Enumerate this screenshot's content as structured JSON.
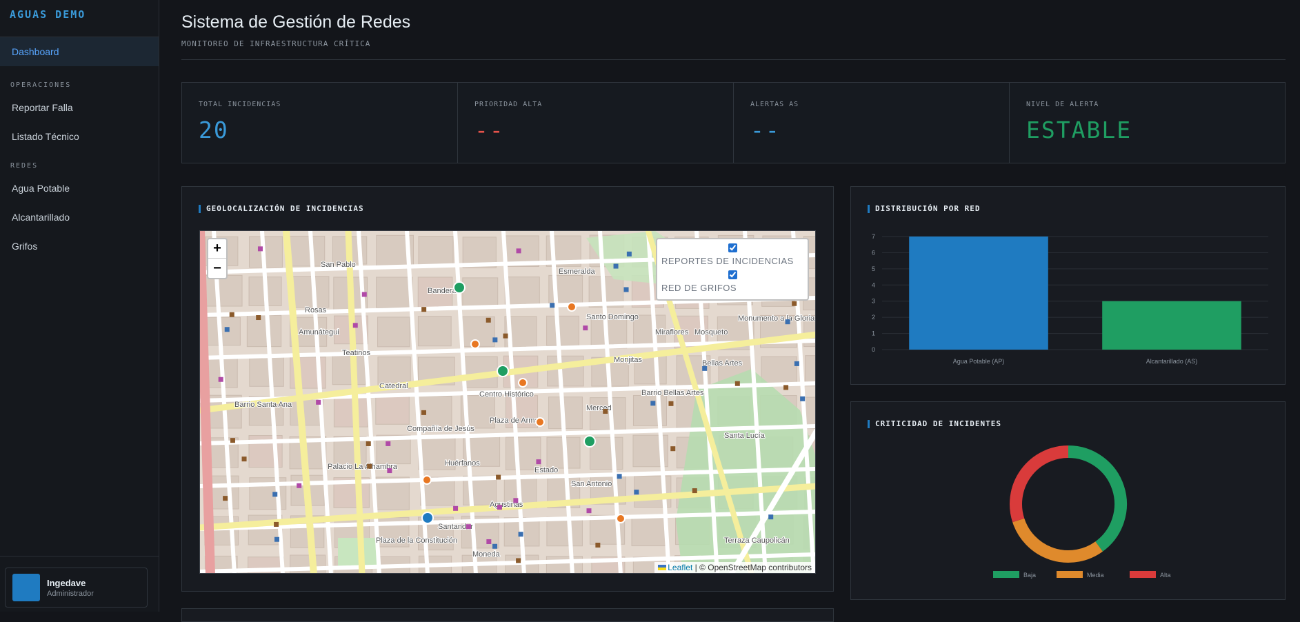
{
  "sidebar": {
    "brand": "AGUAS DEMO",
    "active": "Dashboard",
    "sections": [
      {
        "title": "OPERACIONES",
        "items": [
          "Reportar Falla",
          "Listado Técnico"
        ]
      },
      {
        "title": "REDES",
        "items": [
          "Agua Potable",
          "Alcantarillado",
          "Grifos"
        ]
      }
    ],
    "user": {
      "name": "Ingedave",
      "role": "Administrador"
    }
  },
  "header": {
    "title": "Sistema de Gestión de Redes",
    "subtitle": "MONITOREO DE INFRAESTRUCTURA CRÍTICA"
  },
  "kpis": [
    {
      "label": "TOTAL INCIDENCIAS",
      "value": "20",
      "color": "#3a9ad9"
    },
    {
      "label": "PRIORIDAD ALTA",
      "value": "--",
      "color": "#e5534b"
    },
    {
      "label": "ALERTAS AS",
      "value": "--",
      "color": "#3a9ad9"
    },
    {
      "label": "NIVEL DE ALERTA",
      "value": "ESTABLE",
      "color": "#1f9e62"
    }
  ],
  "map_panel": {
    "title": "GEOLOCALIZACIÓN DE INCIDENCIAS",
    "zoom_in": "+",
    "zoom_out": "−",
    "layers": [
      "REPORTES DE INCIDENCIAS",
      "RED DE GRIFOS"
    ],
    "attribution_link": "Leaflet",
    "attribution_text": "© OpenStreetMap contributors",
    "place_labels": [
      "San Pablo",
      "Rosas",
      "Santo Domingo",
      "Monjitas",
      "Catedral",
      "Centro Histórico",
      "Merced",
      "Barrio Bellas Artes",
      "Huérfanos",
      "Agustinas",
      "Moneda",
      "Plaza de Armas",
      "Compañía de Jesús",
      "Barrio Santa Ana",
      "Palacio La Alhambra",
      "Santander",
      "Plaza de la Constitución",
      "Terraza Caupolicán",
      "Monumento a la Gloria",
      "Bellas Artes",
      "Esmeralda",
      "Bandera",
      "Teatinos",
      "Amunátegui",
      "San Antonio",
      "Mosqueto",
      "Miraflores",
      "Santa Lucía",
      "Estado"
    ]
  },
  "bar_panel": {
    "title": "DISTRIBUCIÓN POR RED"
  },
  "donut_panel": {
    "title": "CRITICIDAD DE INCIDENTES"
  },
  "chart_data": [
    {
      "type": "bar",
      "categories": [
        "Agua Potable (AP)",
        "Alcantarillado (AS)"
      ],
      "values": [
        7,
        3
      ],
      "colors": [
        "#1f7bc1",
        "#1f9e62"
      ],
      "ylim": [
        0,
        7
      ],
      "yticks": [
        0,
        1,
        2,
        3,
        4,
        5,
        6,
        7
      ],
      "grid": true
    },
    {
      "type": "pie",
      "donut": true,
      "categories": [
        "Baja",
        "Media",
        "Alta"
      ],
      "values": [
        8,
        6,
        6
      ],
      "colors": [
        "#1f9e62",
        "#df8a2c",
        "#d93b3b"
      ],
      "legend": "bottom"
    }
  ]
}
